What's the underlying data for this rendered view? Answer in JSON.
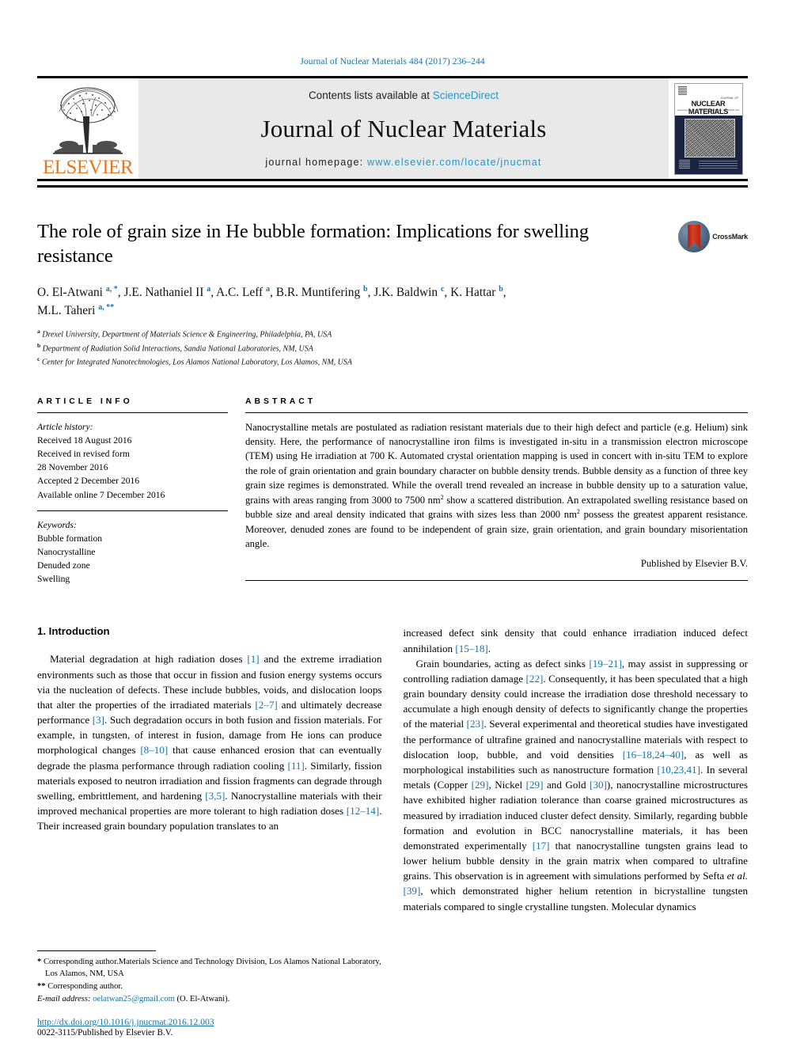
{
  "running_head": "Journal of Nuclear Materials 484 (2017) 236–244",
  "masthead": {
    "publisher_wordmark": "ELSEVIER",
    "contents_prefix": "Contents lists available at ",
    "contents_link": "ScienceDirect",
    "journal_title": "Journal of Nuclear Materials",
    "homepage_prefix": "journal homepage: ",
    "homepage_url": "www.elsevier.com/locate/jnucmat",
    "cover": {
      "kicker": "JOURNAL OF",
      "title": "NUCLEAR MATERIALS",
      "sub_left": "www.elsevier.com/locate/jnucmat",
      "sub_right": "VOLUME 484  ISSUE  JAN 2017"
    }
  },
  "article": {
    "title": "The role of grain size in He bubble formation: Implications for swelling resistance",
    "crossmark_label": "CrossMark",
    "authors_line1_html": "O. El-Atwani <sup>a, *</sup>, J.E. Nathaniel II <sup>a</sup>, A.C. Leff <sup>a</sup>, B.R. Muntifering <sup>b</sup>, J.K. Baldwin <sup>c</sup>, K. Hattar <sup>b</sup>,",
    "authors_line2_html": "M.L. Taheri <sup>a, **</sup>",
    "affiliations": [
      {
        "marker": "a",
        "text": "Drexel University, Department of Materials Science & Engineering, Philadelphia, PA, USA"
      },
      {
        "marker": "b",
        "text": "Department of Radiation Solid Interactions, Sandia National Laboratories, NM, USA"
      },
      {
        "marker": "c",
        "text": "Center for Integrated Nanotechnologies, Los Alamos National Laboratory, Los Alamos, NM, USA"
      }
    ]
  },
  "article_info": {
    "heading": "ARTICLE INFO",
    "history_label": "Article history:",
    "history": [
      "Received 18 August 2016",
      "Received in revised form",
      "28 November 2016",
      "Accepted 2 December 2016",
      "Available online 7 December 2016"
    ],
    "keywords_label": "Keywords:",
    "keywords": [
      "Bubble formation",
      "Nanocrystalline",
      "Denuded zone",
      "Swelling"
    ]
  },
  "abstract": {
    "heading": "ABSTRACT",
    "text_html": "Nanocrystalline metals are postulated as radiation resistant materials due to their high defect and particle (e.g. Helium) sink density. Here, the performance of nanocrystalline iron films is investigated in-situ in a transmission electron microscope (TEM) using He irradiation at 700 K. Automated crystal orientation mapping is used in concert with in-situ TEM to explore the role of grain orientation and grain boundary character on bubble density trends. Bubble density as a function of three key grain size regimes is demonstrated. While the overall trend revealed an increase in bubble density up to a saturation value, grains with areas ranging from 3000 to 7500 nm<sup>2</sup> show a scattered distribution. An extrapolated swelling resistance based on bubble size and areal density indicated that grains with sizes less than 2000 nm<sup>2</sup> possess the greatest apparent resistance. Moreover, denuded zones are found to be independent of grain size, grain orientation, and grain boundary misorientation angle.",
    "published_by": "Published by Elsevier B.V."
  },
  "introduction": {
    "heading": "1. Introduction",
    "left_paragraph_html": "Material degradation at high radiation doses <span class=\"ref\">[1]</span> and the extreme irradiation environments such as those that occur in fission and fusion energy systems occurs via the nucleation of defects. These include bubbles, voids, and dislocation loops that alter the properties of the irradiated materials <span class=\"ref\">[2&ndash;7]</span> and ultimately decrease performance <span class=\"ref\">[3]</span>. Such degradation occurs in both fusion and fission materials. For example, in tungsten, of interest in fusion, damage from He ions can produce morphological changes <span class=\"ref\">[8&ndash;10]</span> that cause enhanced erosion that can eventually degrade the plasma performance through radiation cooling <span class=\"ref\">[11]</span>. Similarly, fission materials exposed to neutron irradiation and fission fragments can degrade through swelling, embrittlement, and hardening <span class=\"ref\">[3,5]</span>. Nanocrystalline materials with their improved mechanical properties are more tolerant to high radiation doses <span class=\"ref\">[12&ndash;14]</span>. Their increased grain boundary population translates to an",
    "right_paragraph_1_html": "increased defect sink density that could enhance irradiation induced defect annihilation <span class=\"ref\">[15&ndash;18]</span>.",
    "right_paragraph_2_html": "Grain boundaries, acting as defect sinks <span class=\"ref\">[19&ndash;21]</span>, may assist in suppressing or controlling radiation damage <span class=\"ref\">[22]</span>. Consequently, it has been speculated that a high grain boundary density could increase the irradiation dose threshold necessary to accumulate a high enough density of defects to significantly change the properties of the material <span class=\"ref\">[23]</span>. Several experimental and theoretical studies have investigated the performance of ultrafine grained and nanocrystalline materials with respect to dislocation loop, bubble, and void densities <span class=\"ref\">[16&ndash;18,24&ndash;40]</span>, as well as morphological instabilities such as nanostructure formation <span class=\"ref\">[10,23,41]</span>. In several metals (Copper <span class=\"ref\">[29]</span>, Nickel <span class=\"ref\">[29]</span> and Gold <span class=\"ref\">[30]</span>), nanocrystalline microstructures have exhibited higher radiation tolerance than coarse grained microstructures as measured by irradiation induced cluster defect density. Similarly, regarding bubble formation and evolution in BCC nanocrystalline materials, it has been demonstrated experimentally <span class=\"ref\">[17]</span> that nanocrystalline tungsten grains lead to lower helium bubble density in the grain matrix when compared to ultrafine grains. This observation is in agreement with simulations performed by Sefta <i>et al.</i> <span class=\"ref\">[39]</span>, which demonstrated higher helium retention in bicrystalline tungsten materials compared to single crystalline tungsten. Molecular dynamics"
  },
  "footnotes": {
    "line1_html": "<span class=\"star\">*</span> Corresponding author.Materials Science and Technology Division, Los Alamos National Laboratory, Los Alamos, NM, USA",
    "line2_html": "<span class=\"star\">**</span> Corresponding author.",
    "line3_html": "<i>E-mail address:</i> <span class=\"fn-mail\">oelatwan25@gmail.com</span> (O. El-Atwani)."
  },
  "footer": {
    "doi": "http://dx.doi.org/10.1016/j.jnucmat.2016.12.003",
    "issn_line": "0022-3115/Published by Elsevier B.V."
  }
}
